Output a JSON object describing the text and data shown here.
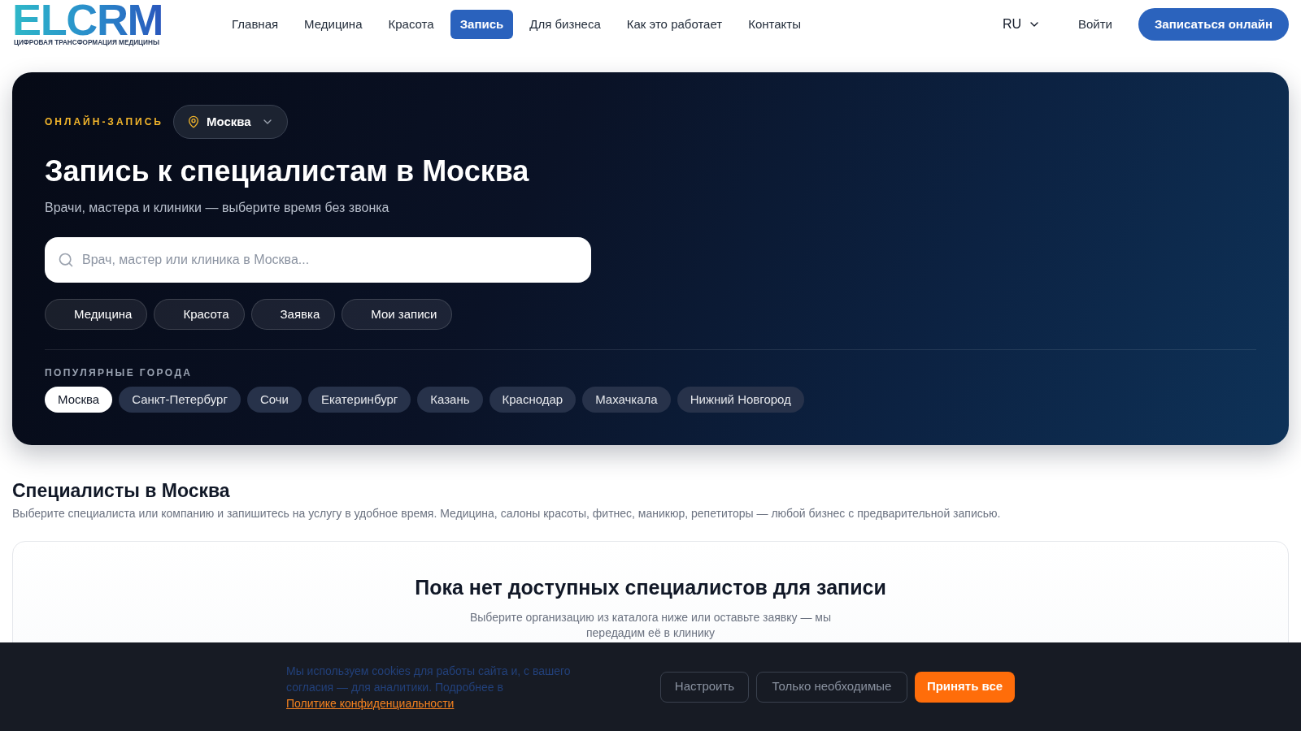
{
  "header": {
    "logo": {
      "wordmark": "ELCRM",
      "tagline": "ЦИФРОВАЯ ТРАНСФОРМАЦИЯ МЕДИЦИНЫ"
    },
    "nav": [
      {
        "label": "Главная",
        "selected": false
      },
      {
        "label": "Медицина",
        "selected": false
      },
      {
        "label": "Красота",
        "selected": false
      },
      {
        "label": "Запись",
        "selected": true
      },
      {
        "label": "Для бизнеса",
        "selected": false
      },
      {
        "label": "Как это работает",
        "selected": false
      },
      {
        "label": "Контакты",
        "selected": false
      }
    ],
    "language": "RU",
    "login": "Войти",
    "cta": "Записаться онлайн"
  },
  "hero": {
    "eyebrow": "ОНЛАЙН-ЗАПИСЬ",
    "city_select": "Москва",
    "title": "Запись к специалистам в Москва",
    "subtitle": "Врачи, мастера и клиники — выберите время без звонка",
    "search": {
      "placeholder": "Врач, мастер или клиника в Москва..."
    },
    "quick_links": [
      "Медицина",
      "Красота",
      "Заявка",
      "Мои записи"
    ],
    "popular_cities_label": "ПОПУЛЯРНЫЕ ГОРОДА",
    "cities": [
      {
        "label": "Москва",
        "selected": true
      },
      {
        "label": "Санкт-Петербург",
        "selected": false
      },
      {
        "label": "Сочи",
        "selected": false
      },
      {
        "label": "Екатеринбург",
        "selected": false
      },
      {
        "label": "Казань",
        "selected": false
      },
      {
        "label": "Краснодар",
        "selected": false
      },
      {
        "label": "Махачкала",
        "selected": false
      },
      {
        "label": "Нижний Новгород",
        "selected": false
      }
    ]
  },
  "specialists": {
    "title": "Специалисты в Москва",
    "description": "Выберите специалиста или компанию и запишитесь на услугу в удобное время. Медицина, салоны красоты, фитнес, маникюр, репетиторы — любой бизнес с предварительной записью.",
    "empty_state": {
      "title": "Пока нет доступных специалистов для записи",
      "text": "Выберите организацию из каталога ниже или оставьте заявку — мы передадим её в клинику"
    }
  },
  "cookie_banner": {
    "text": "Мы используем cookies для работы сайта и, с вашего согласия — для аналитики. Подробнее в",
    "link": "Политике конфиденциальности",
    "buttons": [
      {
        "label": "Настроить",
        "kind": "outline"
      },
      {
        "label": "Только необходимые",
        "kind": "outline"
      },
      {
        "label": "Принять все",
        "kind": "primary"
      }
    ]
  }
}
